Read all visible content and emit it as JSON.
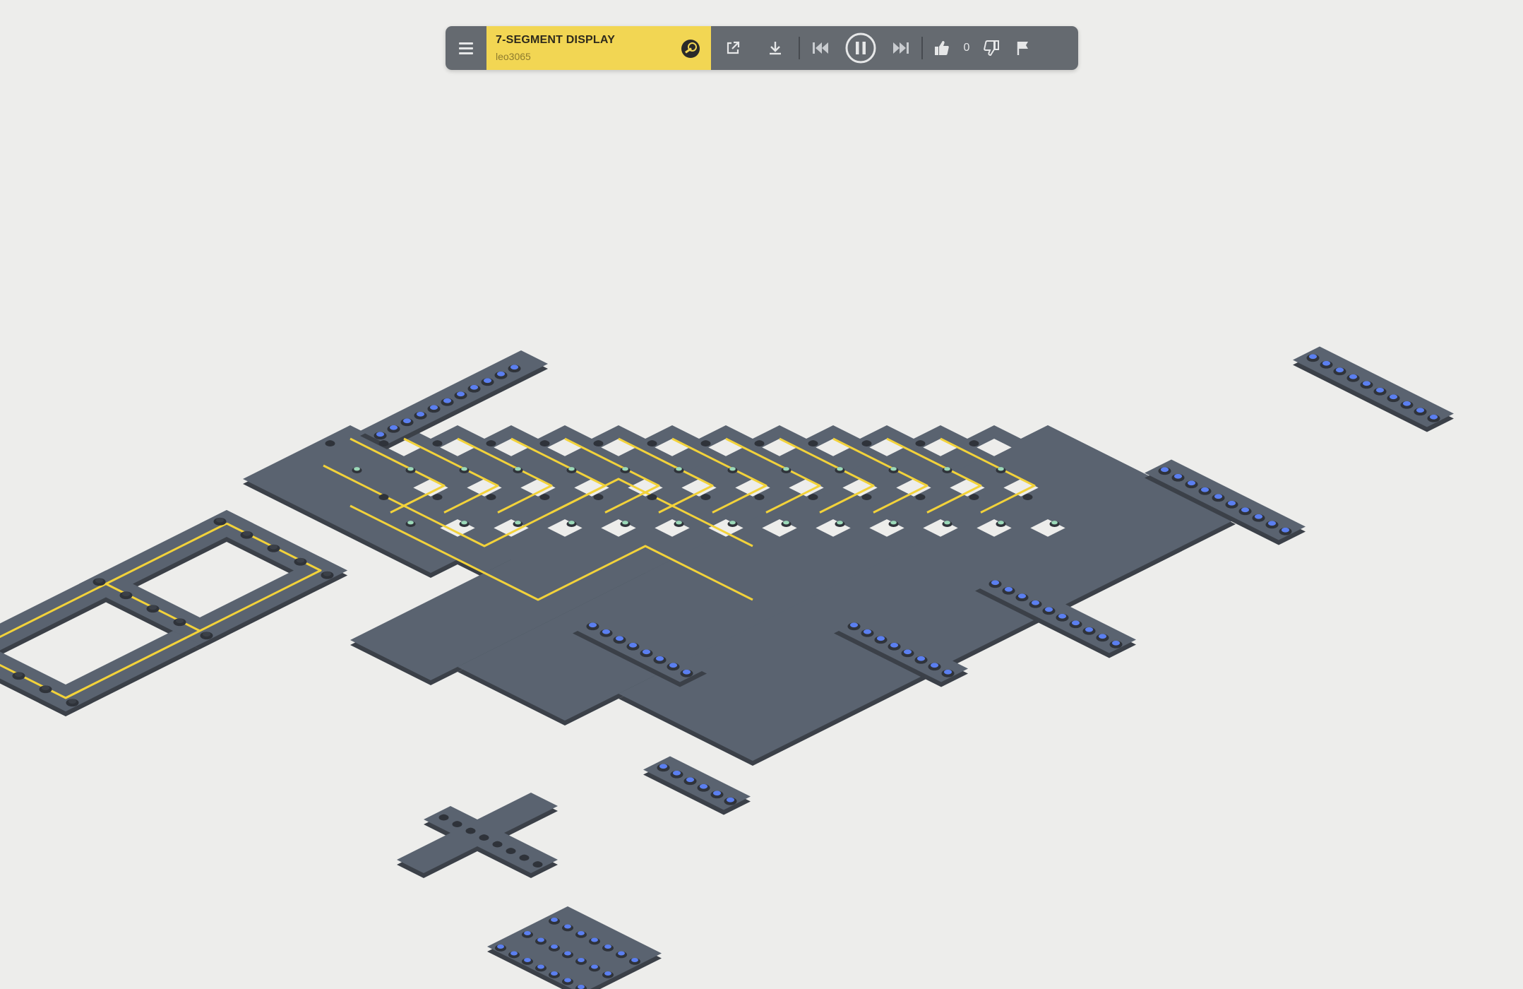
{
  "puzzle": {
    "title": "7-SEGMENT DISPLAY",
    "author": "leo3065",
    "likes": "0"
  },
  "toolbar": {
    "items": [
      {
        "icon": "menu-icon"
      },
      {
        "icon": "steam-icon"
      },
      {
        "icon": "share-icon"
      },
      {
        "icon": "download-icon"
      },
      {
        "icon": "skip-back-icon"
      },
      {
        "icon": "pause-icon"
      },
      {
        "icon": "skip-forward-icon"
      },
      {
        "icon": "thumbs-up-icon"
      },
      {
        "icon": "thumbs-down-icon"
      },
      {
        "icon": "flag-icon"
      }
    ]
  },
  "colors": {
    "background": "#ededeb",
    "board": "#5a6370",
    "board_edge": "#3b4048",
    "wire": "#f2d23a",
    "input_node": "#5b7ff0",
    "output_node": "#9bd9b8",
    "title_card": "#f2d653",
    "toolbar": "#5e6369"
  }
}
